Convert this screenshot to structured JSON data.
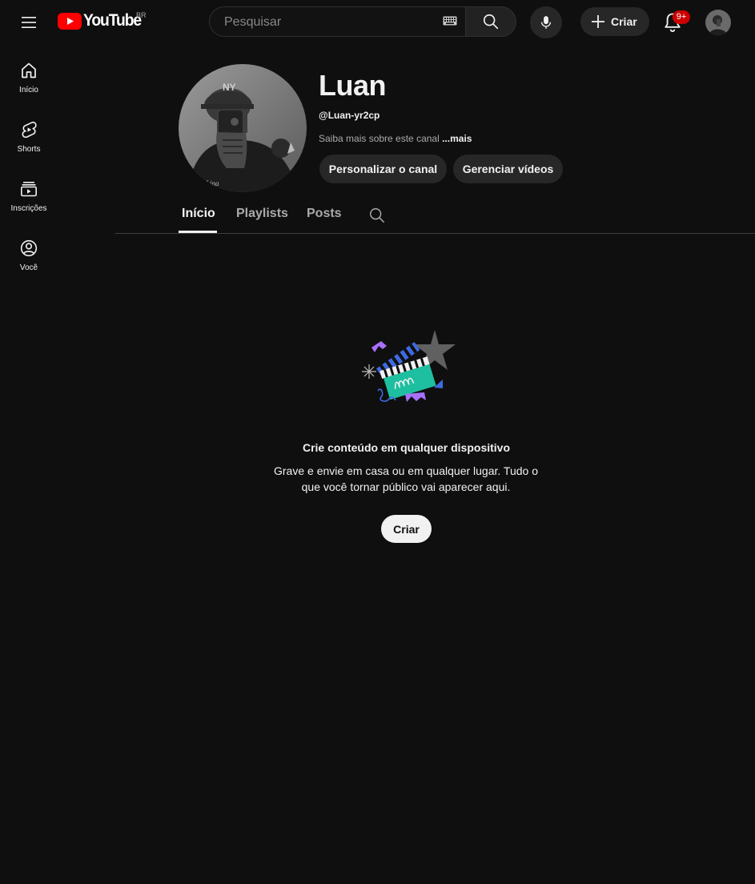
{
  "header": {
    "logo_text": "YouTube",
    "country_code": "BR",
    "search_placeholder": "Pesquisar",
    "create_label": "Criar",
    "notification_count": "9+",
    "colors": {
      "brand_red": "#ff0000",
      "badge": "#cc0000",
      "background": "#0f0f0f"
    }
  },
  "sidebar": {
    "items": [
      {
        "label": "Início",
        "icon": "home-icon"
      },
      {
        "label": "Shorts",
        "icon": "shorts-icon"
      },
      {
        "label": "Inscrições",
        "icon": "subscriptions-icon"
      },
      {
        "label": "Você",
        "icon": "you-icon"
      }
    ]
  },
  "channel": {
    "name": "Luan",
    "handle": "@Luan-yr2cp",
    "about_text": "Saiba mais sobre este canal",
    "about_more": "...mais",
    "avatar_caption": "Lina",
    "buttons": {
      "customize": "Personalizar o canal",
      "manage": "Gerenciar vídeos"
    }
  },
  "tabs": [
    {
      "label": "Início",
      "active": true
    },
    {
      "label": "Playlists",
      "active": false
    },
    {
      "label": "Posts",
      "active": false
    }
  ],
  "empty_state": {
    "title": "Crie conteúdo em qualquer dispositivo",
    "description": "Grave e envie em casa ou em qualquer lugar. Tudo o que você tornar público vai aparecer aqui.",
    "button": "Criar"
  }
}
